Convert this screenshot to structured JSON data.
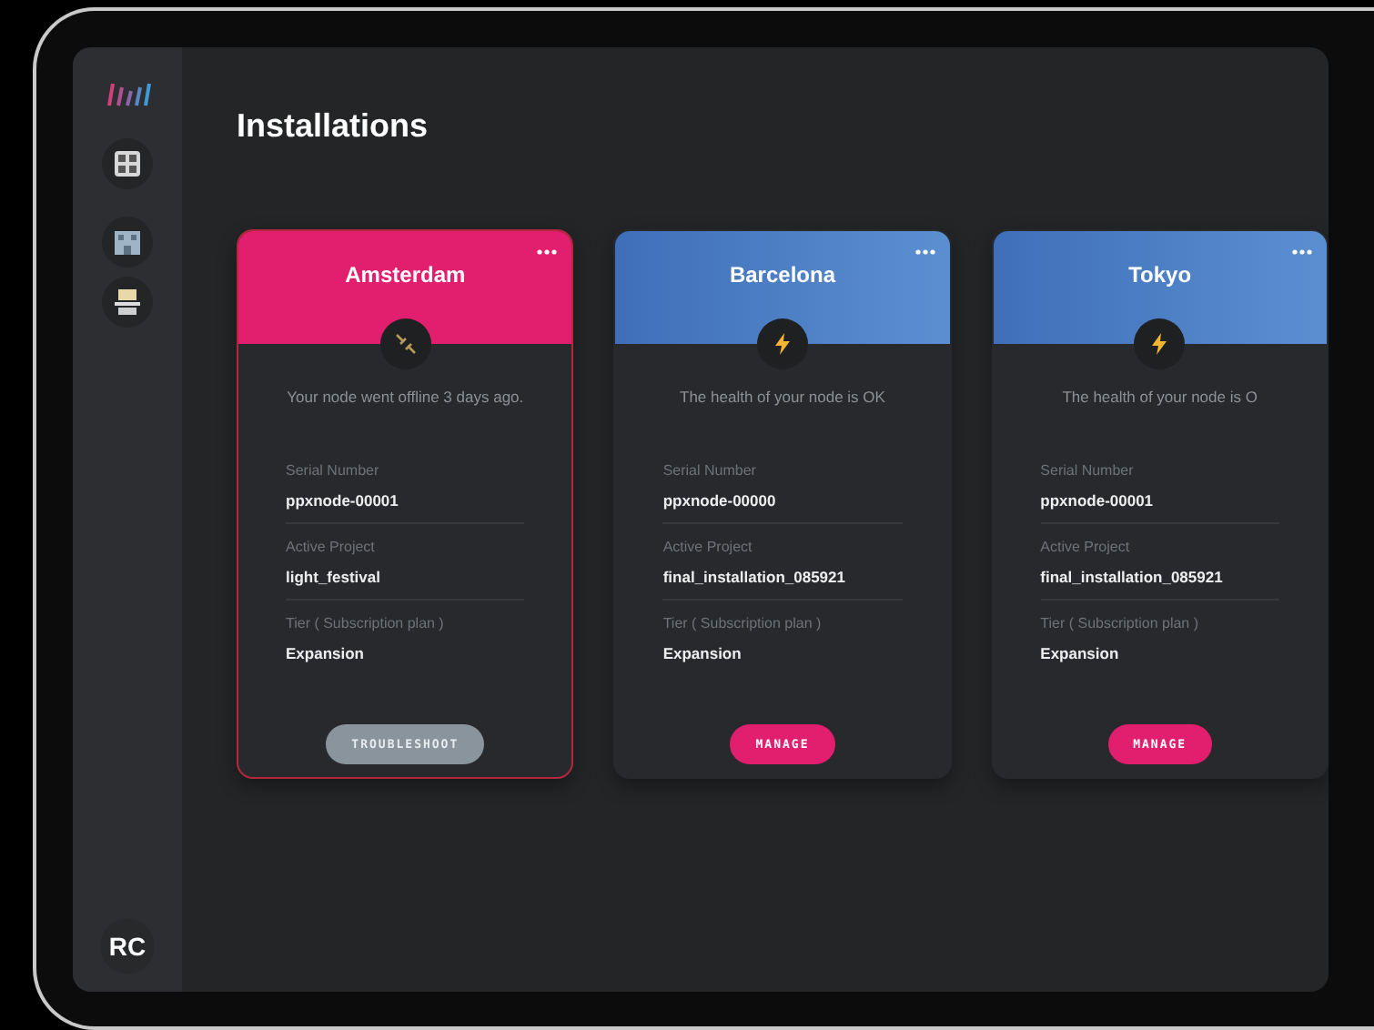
{
  "page": {
    "title": "Installations"
  },
  "sidebar": {
    "avatar": "RC"
  },
  "installations": [
    {
      "city": "Amsterdam",
      "kind": "offline",
      "message": "Your node went offline 3 days ago.",
      "fields": [
        {
          "label": "Serial Number",
          "value": "ppxnode-00001"
        },
        {
          "label": "Active Project",
          "value": "light_festival"
        },
        {
          "label": "Tier ( Subscription plan )",
          "value": "Expansion"
        }
      ],
      "action": "TROUBLESHOOT"
    },
    {
      "city": "Barcelona",
      "kind": "ok",
      "message": "The health of your node is OK",
      "fields": [
        {
          "label": "Serial Number",
          "value": "ppxnode-00000"
        },
        {
          "label": "Active Project",
          "value": "final_installation_085921"
        },
        {
          "label": "Tier ( Subscription plan )",
          "value": "Expansion"
        }
      ],
      "action": "MANAGE"
    },
    {
      "city": "Tokyo",
      "kind": "ok",
      "message": "The health of your node is O",
      "fields": [
        {
          "label": "Serial Number",
          "value": "ppxnode-00001"
        },
        {
          "label": "Active Project",
          "value": "final_installation_085921"
        },
        {
          "label": "Tier ( Subscription plan )",
          "value": "Expansion"
        }
      ],
      "action": "MANAGE"
    }
  ]
}
